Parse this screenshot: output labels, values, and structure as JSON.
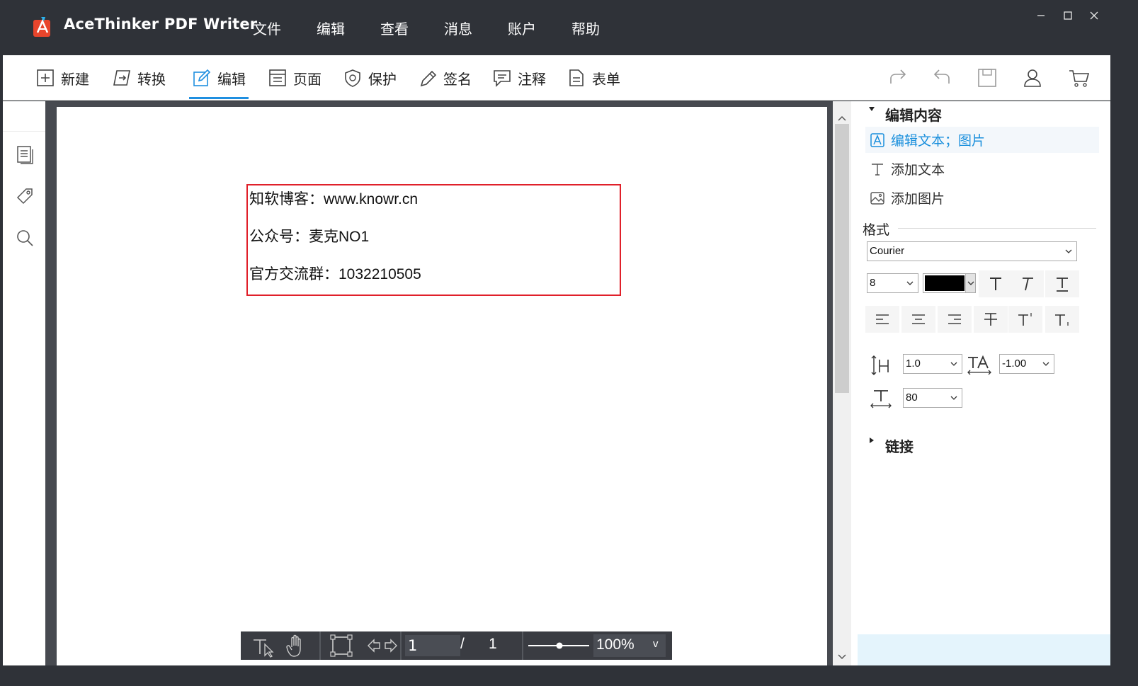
{
  "app": {
    "title": "AceThinker PDF Writer"
  },
  "menu": [
    "文件",
    "编辑",
    "查看",
    "消息",
    "账户",
    "帮助"
  ],
  "window_controls": [
    "minimize-icon",
    "maximize-icon",
    "close-icon"
  ],
  "toolbar": {
    "items": [
      {
        "label": "新建",
        "icon": "plus-box-icon"
      },
      {
        "label": "转换",
        "icon": "convert-icon"
      },
      {
        "label": "编辑",
        "icon": "edit-pencil-icon",
        "active": true
      },
      {
        "label": "页面",
        "icon": "page-icon"
      },
      {
        "label": "保护",
        "icon": "shield-icon"
      },
      {
        "label": "签名",
        "icon": "pen-icon"
      },
      {
        "label": "注释",
        "icon": "comment-icon"
      },
      {
        "label": "表单",
        "icon": "form-icon"
      }
    ],
    "right_icons": [
      "redo-icon",
      "undo-icon",
      "save-icon",
      "user-icon",
      "cart-icon"
    ],
    "accent": "#1f8fe0"
  },
  "sidebar": {
    "icons": [
      "pages-icon",
      "bookmark-tag-icon",
      "search-icon"
    ]
  },
  "document": {
    "lines": [
      "知软博客：www.knowr.cn",
      "公众号：麦克NO1",
      "官方交流群：1032210505"
    ],
    "selection_color": "#e0202a"
  },
  "navbar": {
    "current_page": "1",
    "separator": "/",
    "total_pages": "1",
    "zoom": "100%",
    "zoom_toggle": "v"
  },
  "panel": {
    "edit_content_header": "编辑内容",
    "edit_items": [
      {
        "label": "编辑文本；图片",
        "icon": "edit-text-image-icon",
        "selected": true
      },
      {
        "label": "添加文本",
        "icon": "add-text-icon"
      },
      {
        "label": "添加图片",
        "icon": "add-image-icon"
      }
    ],
    "format_label": "格式",
    "font_family": "Courier",
    "font_size": "8",
    "font_color": "#000000",
    "line_spacing": "1.0",
    "char_spacing": "-1.00",
    "scale": "80",
    "link_header": "链接",
    "selected_color": "#1a8fdc"
  }
}
